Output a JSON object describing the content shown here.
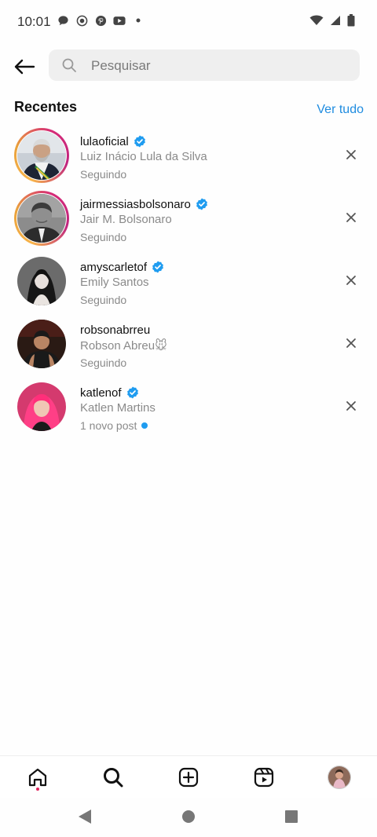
{
  "status_bar": {
    "time": "10:01",
    "left_icons": [
      "chat-bubble-icon",
      "record-icon",
      "pinterest-icon",
      "youtube-icon",
      "dot-icon"
    ],
    "right_icons": [
      "wifi-icon",
      "signal-icon",
      "battery-icon"
    ]
  },
  "search": {
    "placeholder": "Pesquisar",
    "value": ""
  },
  "recent": {
    "title": "Recentes",
    "see_all": "Ver tudo",
    "items": [
      {
        "username": "lulaoficial",
        "verified": true,
        "full_name": "Luiz Inácio Lula da Silva",
        "subtitle": "Seguindo",
        "story_ring": true,
        "new_post": false
      },
      {
        "username": "jairmessiasbolsonaro",
        "verified": true,
        "full_name": "Jair M. Bolsonaro",
        "subtitle": "Seguindo",
        "story_ring": true,
        "new_post": false
      },
      {
        "username": "amyscarletof",
        "verified": true,
        "full_name": "Emily Santos",
        "subtitle": "Seguindo",
        "story_ring": false,
        "new_post": false
      },
      {
        "username": "robsonabrreu",
        "verified": false,
        "full_name": "Robson Abreu🐭",
        "subtitle": "Seguindo",
        "story_ring": false,
        "new_post": false
      },
      {
        "username": "katlenof",
        "verified": true,
        "full_name": "Katlen Martins",
        "subtitle": "1 novo post",
        "story_ring": false,
        "new_post": true
      }
    ]
  },
  "bottom_nav": {
    "items": [
      "home-icon",
      "search-icon",
      "create-post-icon",
      "reels-icon",
      "profile-avatar"
    ],
    "active": "search-icon"
  },
  "system_nav": [
    "back-triangle-icon",
    "home-circle-icon",
    "recents-square-icon"
  ],
  "colors": {
    "accent": "#1f8ce0",
    "verified": "#1f9cf0",
    "muted_text": "#8a8a8a",
    "search_bg": "#efefef"
  }
}
